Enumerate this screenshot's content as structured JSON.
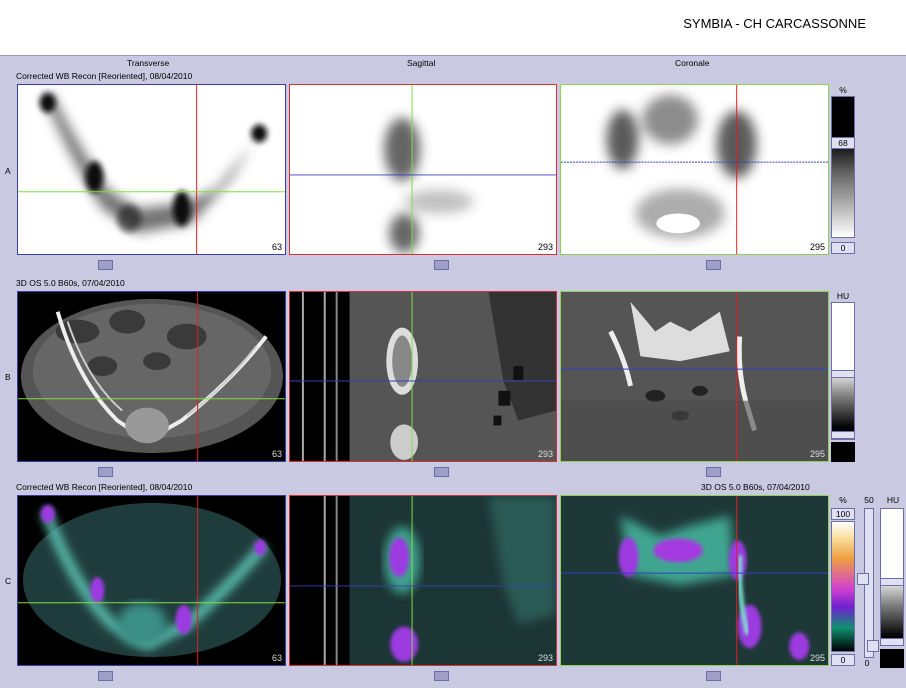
{
  "header": {
    "title": "SYMBIA - CH CARCASSONNE"
  },
  "columns": {
    "transverse": "Transverse",
    "sagittal": "Sagittal",
    "coronal": "Coronale"
  },
  "rows": {
    "a": {
      "letter": "A",
      "caption": "Corrected WB Recon [Reoriented], 08/04/2010"
    },
    "b": {
      "letter": "B",
      "caption": "3D  OS  5.0  B60s, 07/04/2010"
    },
    "c": {
      "letter": "C",
      "caption_left": "Corrected WB Recon [Reoriented], 08/04/2010",
      "caption_right": "3D  OS  5.0  B60s, 07/04/2010"
    }
  },
  "slices": {
    "transverse": "63",
    "sagittal": "293",
    "coronal": "295"
  },
  "colorbars": {
    "a": {
      "unit": "%",
      "top": "68",
      "bottom": "0"
    },
    "b": {
      "unit": "HU"
    },
    "c": {
      "unit_pet": "%",
      "pet_top": "100",
      "pet_bottom": "0",
      "fuse_top": "50",
      "fuse_bottom": "0",
      "unit_ct": "HU"
    }
  },
  "colors": {
    "frame_red": "#d43030",
    "frame_green": "#90d050",
    "frame_blue": "#4040b0",
    "crosshair_red": "#e02020",
    "crosshair_green": "#80e040",
    "crosshair_blue": "#3040c0",
    "bg": "#c9c9e1"
  }
}
